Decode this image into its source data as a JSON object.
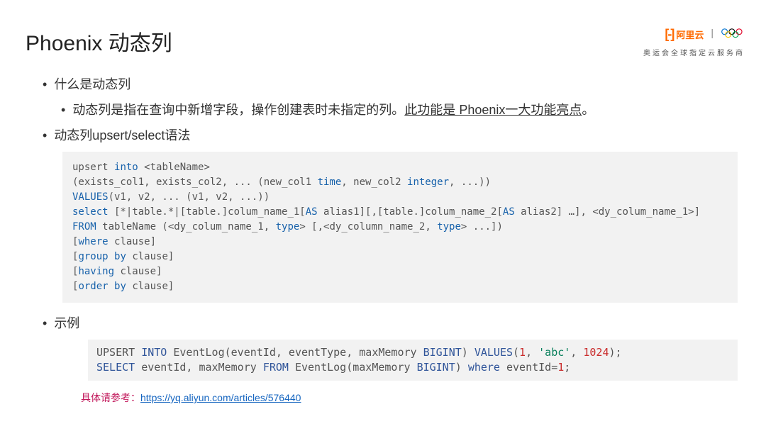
{
  "title": "Phoenix 动态列",
  "logo": {
    "aliyun_bracket": "[-]",
    "aliyun_text": "阿里云",
    "sponsor_text": "奥运会全球指定云服务商"
  },
  "bullets": {
    "b1": "什么是动态列",
    "b1_sub_pre": "动态列是指在查询中新增字段，操作创建表时未指定的列。",
    "b1_sub_underline": "此功能是 Phoenix一大功能亮点",
    "b1_sub_post": "。",
    "b2": "动态列upsert/select语法",
    "b3": "示例"
  },
  "code1": {
    "l1a": "upsert ",
    "l1b": "into",
    "l1c": " <tableName>",
    "l2a": "(exists_col1, exists_col2, ... (new_col1 ",
    "l2b": "time",
    "l2c": ", new_col2 ",
    "l2d": "integer",
    "l2e": ", ...))",
    "l3a": "VALUES",
    "l3b": "(v1, v2, ... (v1, v2, ...))",
    "l4": "",
    "l5a": "select",
    "l5b": " [*|table.*|[table.]colum_name_1[",
    "l5c": "AS",
    "l5d": " alias1][,[table.]colum_name_2[",
    "l5e": "AS",
    "l5f": " alias2] …], <dy_colum_name_1>]",
    "l6a": "FROM",
    "l6b": " tableName (<dy_colum_name_1, ",
    "l6c": "type",
    "l6d": "> [,<dy_column_name_2, ",
    "l6e": "type",
    "l6f": "> ...])",
    "l7a": "[",
    "l7b": "where",
    "l7c": " clause]",
    "l8a": "[",
    "l8b": "group",
    "l8c": " ",
    "l8d": "by",
    "l8e": " clause]",
    "l9a": "[",
    "l9b": "having",
    "l9c": " clause]",
    "l10a": "[",
    "l10b": "order",
    "l10c": " ",
    "l10d": "by",
    "l10e": " clause]"
  },
  "code2": {
    "l1a": "UPSERT ",
    "l1b": "INTO",
    "l1c": " EventLog(eventId, eventType, maxMemory ",
    "l1d": "BIGINT",
    "l1e": ") ",
    "l1f": "VALUES",
    "l1g": "(",
    "l1h": "1",
    "l1i": ", ",
    "l1j": "'abc'",
    "l1k": ", ",
    "l1l": "1024",
    "l1m": ");",
    "l2a": "SELECT",
    "l2b": " eventId, maxMemory ",
    "l2c": "FROM",
    "l2d": " EventLog(maxMemory ",
    "l2e": "BIGINT",
    "l2f": ") ",
    "l2g": "where",
    "l2h": " eventId=",
    "l2i": "1",
    "l2j": ";"
  },
  "reference": {
    "label": "具体请参考：",
    "url": "https://yq.aliyun.com/articles/576440"
  }
}
